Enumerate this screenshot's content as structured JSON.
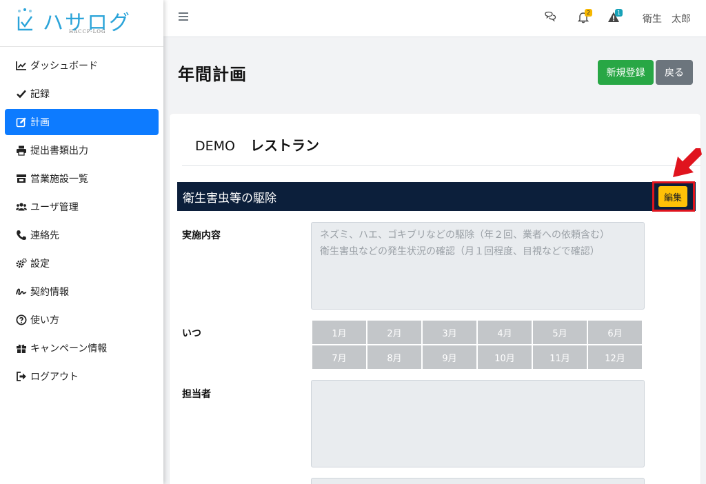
{
  "app": {
    "logo_text": "ハサログ",
    "logo_sub": "HACCP-LOG"
  },
  "sidebar": {
    "items": [
      {
        "label": "ダッシュボード",
        "icon": "chart-line-icon",
        "active": false
      },
      {
        "label": "記録",
        "icon": "check-icon",
        "active": false
      },
      {
        "label": "計画",
        "icon": "edit-icon",
        "active": true
      },
      {
        "label": "提出書類出力",
        "icon": "print-icon",
        "active": false
      },
      {
        "label": "営業施設一覧",
        "icon": "store-icon",
        "active": false
      },
      {
        "label": "ユーザ管理",
        "icon": "users-icon",
        "active": false
      },
      {
        "label": "連絡先",
        "icon": "phone-icon",
        "active": false
      },
      {
        "label": "設定",
        "icon": "gears-icon",
        "active": false
      },
      {
        "label": "契約情報",
        "icon": "signature-icon",
        "active": false
      },
      {
        "label": "使い方",
        "icon": "question-circle-icon",
        "active": false
      },
      {
        "label": "キャンペーン情報",
        "icon": "gift-icon",
        "active": false
      },
      {
        "label": "ログアウト",
        "icon": "sign-out-icon",
        "active": false
      }
    ]
  },
  "topbar": {
    "notifications_count": "2",
    "alerts_count": "1",
    "user_name": "衛生　太郎"
  },
  "page": {
    "title": "年間計画",
    "new_button": "新規登録",
    "back_button": "戻る"
  },
  "card": {
    "company": "DEMO",
    "shop": "レストラン",
    "section_title": "衛生害虫等の駆除",
    "edit_button": "編集",
    "fields": {
      "content_label": "実施内容",
      "content_placeholder_line1": "ネズミ、ハエ、ゴキブリなどの駆除（年２回、業者への依頼含む）",
      "content_placeholder_line2": "衛生害虫などの発生状況の確認（月１回程度、目視などで確認）",
      "when_label": "いつ",
      "person_label": "担当者"
    },
    "months": [
      "1月",
      "2月",
      "3月",
      "4月",
      "5月",
      "6月",
      "7月",
      "8月",
      "9月",
      "10月",
      "11月",
      "12月"
    ]
  },
  "colors": {
    "primary": "#0d7bff",
    "success": "#28a745",
    "secondary": "#6c757d",
    "warning": "#ffc107",
    "section_bar": "#0c1f3b",
    "highlight": "#e0141e",
    "logo": "#2ba4d9"
  }
}
